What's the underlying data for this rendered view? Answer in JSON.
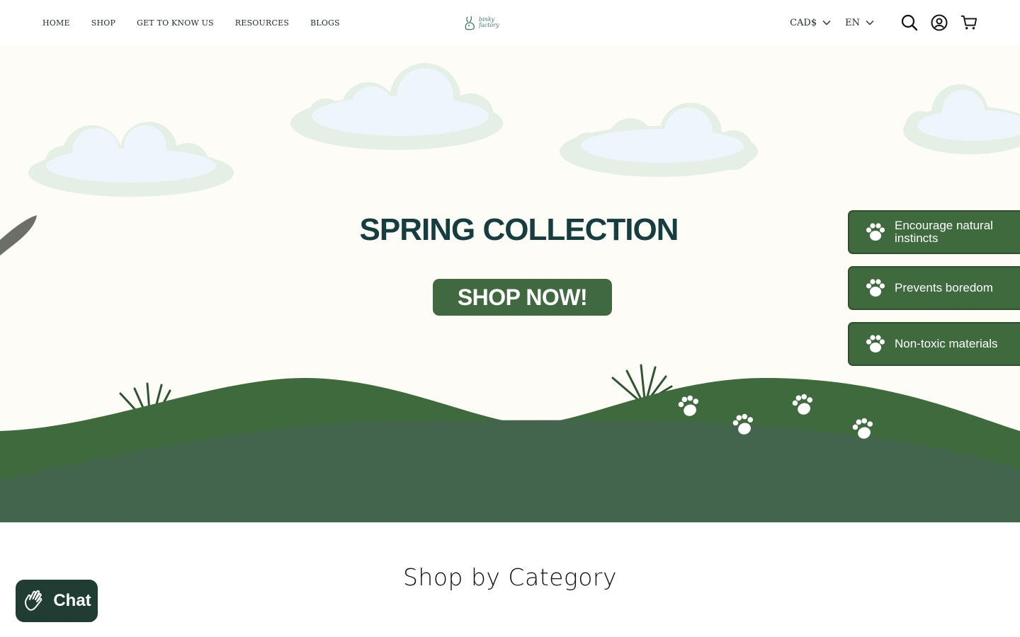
{
  "nav": {
    "items": [
      {
        "label": "HOME"
      },
      {
        "label": "SHOP"
      },
      {
        "label": "GET TO KNOW US"
      },
      {
        "label": "RESOURCES"
      },
      {
        "label": "BLOGS"
      }
    ]
  },
  "logo": {
    "line1": "binky",
    "line2": "factory"
  },
  "header": {
    "currency": "CAD$",
    "language": "EN",
    "icons": [
      "search-icon",
      "account-icon",
      "cart-icon"
    ]
  },
  "hero": {
    "title": "SPRING COLLECTION",
    "button_label": "SHOP NOW!",
    "badges": [
      {
        "label": "Encourage natural instincts"
      },
      {
        "label": "Prevents boredom"
      },
      {
        "label": "Non-toxic materials"
      }
    ]
  },
  "colors": {
    "hero_background": "#fdfcf6",
    "grass_light": "#3f6a3d",
    "grass_dark": "#43654e",
    "title": "#163d3f",
    "chat": "#1f3d33"
  },
  "section": {
    "title": "Shop by Category"
  },
  "chat": {
    "label": "Chat"
  }
}
